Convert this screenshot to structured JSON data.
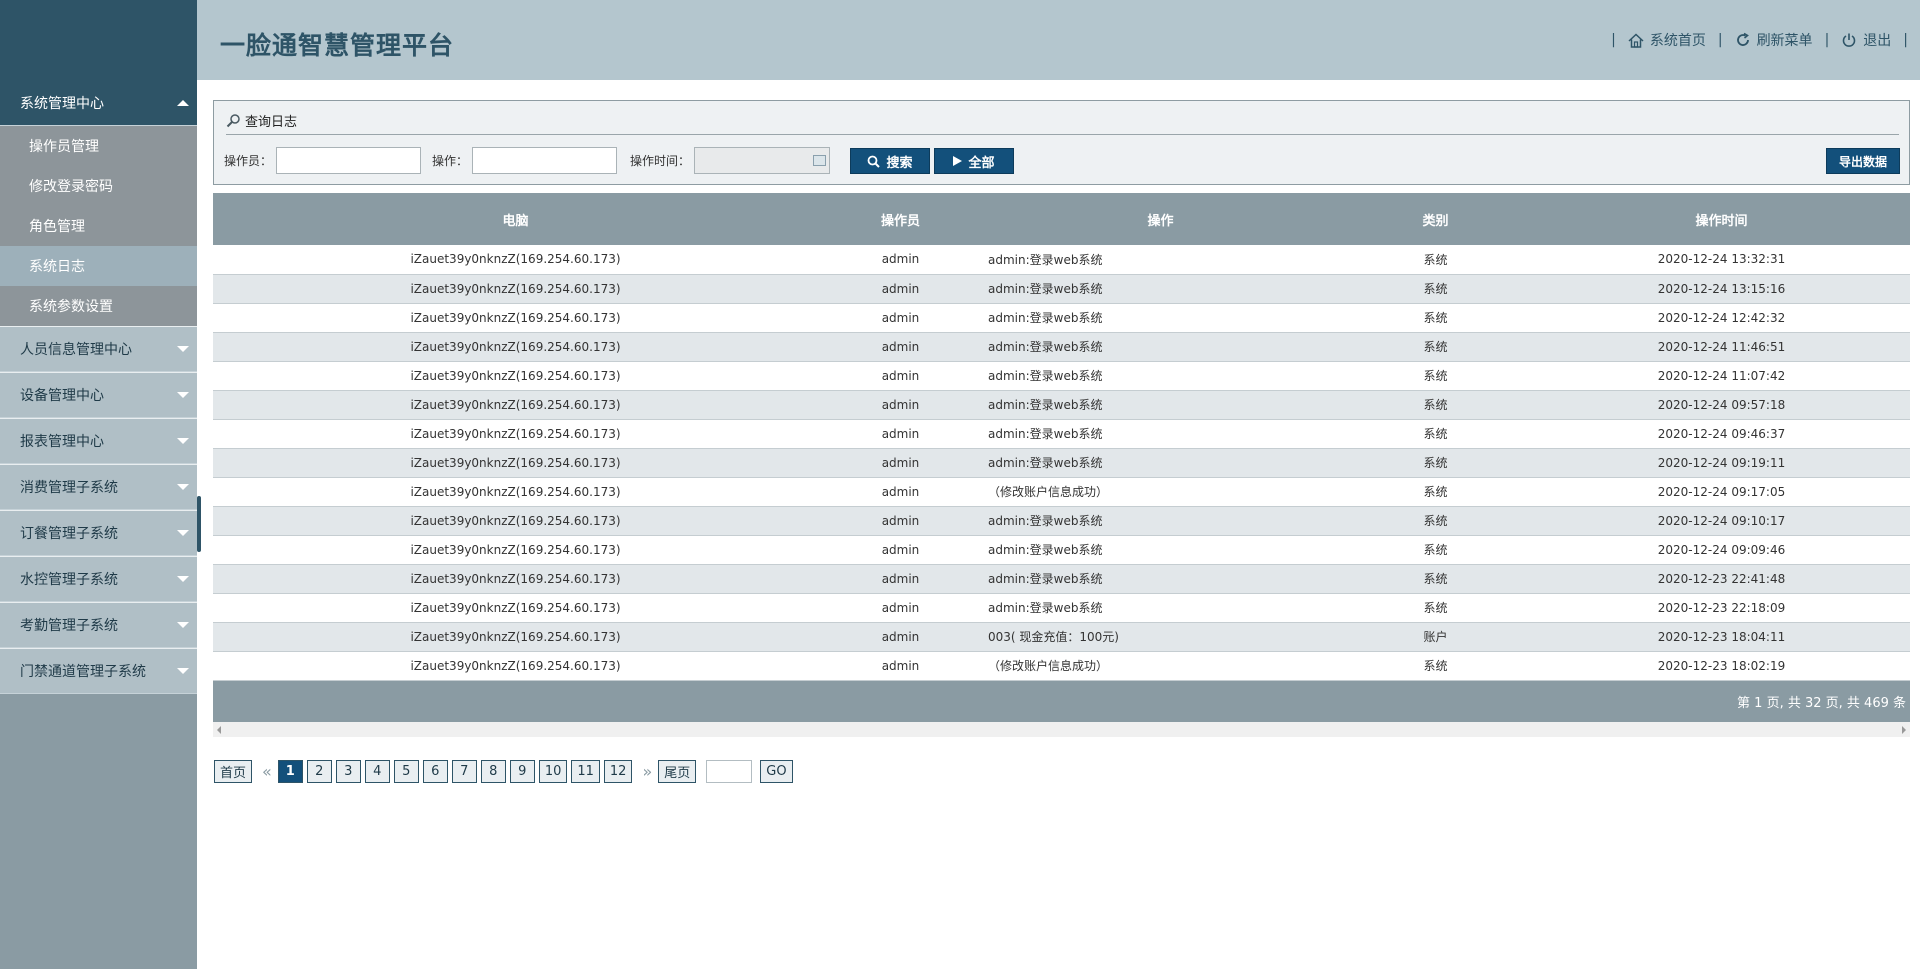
{
  "header": {
    "title": "一脸通智慧管理平台",
    "links": [
      {
        "label": "系统首页",
        "icon": "home-icon"
      },
      {
        "label": "刷新菜单",
        "icon": "refresh-icon"
      },
      {
        "label": "退出",
        "icon": "power-icon"
      }
    ],
    "separator": "|"
  },
  "sidebar": {
    "active_group": {
      "label": "系统管理中心",
      "items": [
        "操作员管理",
        "修改登录密码",
        "角色管理",
        "系统日志",
        "系统参数设置"
      ],
      "active_item": "系统日志"
    },
    "groups": [
      "人员信息管理中心",
      "设备管理中心",
      "报表管理中心",
      "消费管理子系统",
      "订餐管理子系统",
      "水控管理子系统",
      "考勤管理子系统",
      "门禁通道管理子系统"
    ]
  },
  "query": {
    "title": "查询日志",
    "operator_label": "操作员：",
    "operator_value": "",
    "action_label": "操作：",
    "action_value": "",
    "time_label": "操作时间：",
    "time_value": "",
    "search_label": "搜索",
    "all_label": "全部",
    "export_label": "导出数据"
  },
  "table": {
    "columns": [
      "电脑",
      "操作员",
      "操作",
      "类别",
      "操作时间"
    ],
    "rows": [
      [
        "iZauet39y0nknzZ(169.254.60.173)",
        "admin",
        "admin:登录web系统",
        "系统",
        "2020-12-24 13:32:31"
      ],
      [
        "iZauet39y0nknzZ(169.254.60.173)",
        "admin",
        "admin:登录web系统",
        "系统",
        "2020-12-24 13:15:16"
      ],
      [
        "iZauet39y0nknzZ(169.254.60.173)",
        "admin",
        "admin:登录web系统",
        "系统",
        "2020-12-24 12:42:32"
      ],
      [
        "iZauet39y0nknzZ(169.254.60.173)",
        "admin",
        "admin:登录web系统",
        "系统",
        "2020-12-24 11:46:51"
      ],
      [
        "iZauet39y0nknzZ(169.254.60.173)",
        "admin",
        "admin:登录web系统",
        "系统",
        "2020-12-24 11:07:42"
      ],
      [
        "iZauet39y0nknzZ(169.254.60.173)",
        "admin",
        "admin:登录web系统",
        "系统",
        "2020-12-24 09:57:18"
      ],
      [
        "iZauet39y0nknzZ(169.254.60.173)",
        "admin",
        "admin:登录web系统",
        "系统",
        "2020-12-24 09:46:37"
      ],
      [
        "iZauet39y0nknzZ(169.254.60.173)",
        "admin",
        "admin:登录web系统",
        "系统",
        "2020-12-24 09:19:11"
      ],
      [
        "iZauet39y0nknzZ(169.254.60.173)",
        "admin",
        "（修改账户信息成功）",
        "系统",
        "2020-12-24 09:17:05"
      ],
      [
        "iZauet39y0nknzZ(169.254.60.173)",
        "admin",
        "admin:登录web系统",
        "系统",
        "2020-12-24 09:10:17"
      ],
      [
        "iZauet39y0nknzZ(169.254.60.173)",
        "admin",
        "admin:登录web系统",
        "系统",
        "2020-12-24 09:09:46"
      ],
      [
        "iZauet39y0nknzZ(169.254.60.173)",
        "admin",
        "admin:登录web系统",
        "系统",
        "2020-12-23 22:41:48"
      ],
      [
        "iZauet39y0nknzZ(169.254.60.173)",
        "admin",
        "admin:登录web系统",
        "系统",
        "2020-12-23 22:18:09"
      ],
      [
        "iZauet39y0nknzZ(169.254.60.173)",
        "admin",
        "003( 现金充值：100元)",
        "账户",
        "2020-12-23 18:04:11"
      ],
      [
        "iZauet39y0nknzZ(169.254.60.173)",
        "admin",
        "（修改账户信息成功）",
        "系统",
        "2020-12-23 18:02:19"
      ]
    ],
    "summary": "第 1 页, 共 32 页, 共 469 条"
  },
  "pager": {
    "first": "首页",
    "prev": "«",
    "pages": [
      "1",
      "2",
      "3",
      "4",
      "5",
      "6",
      "7",
      "8",
      "9",
      "10",
      "11",
      "12"
    ],
    "current": "1",
    "next": "»",
    "last": "尾页",
    "go": "GO"
  },
  "colors": {
    "brand_dark": "#2e5467",
    "button": "#13507b",
    "grid_header": "#8a9ba3",
    "header_bg": "#b4c6ce"
  }
}
